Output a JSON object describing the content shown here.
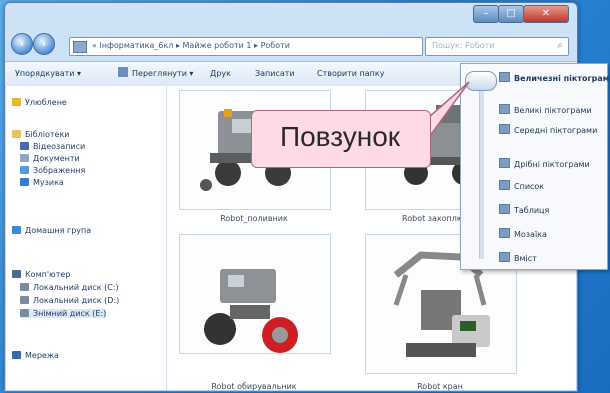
{
  "window": {
    "controls": {
      "minimize": "–",
      "maximize": "□",
      "close": "✕"
    }
  },
  "addressbar": {
    "path": "« Інформатика_6кл ▸ Майже роботи 1 ▸ Роботи",
    "search_placeholder": "Пошук: Роботи"
  },
  "toolbar": {
    "items": [
      "Упорядкувати ▾",
      "Переглянути ▾",
      "Друк",
      "Записати",
      "Створити папку"
    ]
  },
  "sidebar": {
    "items": [
      {
        "label": "Улюблене",
        "icon": "star-icon",
        "color": "#e8b828"
      },
      {
        "label": "Бібліотеки",
        "icon": "library-icon",
        "color": "#e8c25a"
      },
      {
        "label": "Відеозаписи",
        "icon": "video-icon",
        "color": "#4a6aa8"
      },
      {
        "label": "Документи",
        "icon": "documents-icon",
        "color": "#8aa6c8"
      },
      {
        "label": "Зображення",
        "icon": "pictures-icon",
        "color": "#5a9ad8"
      },
      {
        "label": "Музика",
        "icon": "music-icon",
        "color": "#3a7ad0"
      },
      {
        "label": "Домашня група",
        "icon": "homegroup-icon",
        "color": "#3a8ad8"
      },
      {
        "label": "Комп'ютер",
        "icon": "computer-icon",
        "color": "#4a6a90"
      },
      {
        "label": "Локальний диск (C:)",
        "icon": "disk-icon",
        "color": "#7a8aa0"
      },
      {
        "label": "Локальний диск (D:)",
        "icon": "disk-icon",
        "color": "#7a8aa0"
      },
      {
        "label": "Знімний диск (E:)",
        "icon": "usb-icon",
        "color": "#7a8aa0"
      },
      {
        "label": "Мережа",
        "icon": "network-icon",
        "color": "#3a6aa8"
      }
    ]
  },
  "files": [
    {
      "name": "Robot_поливник"
    },
    {
      "name": "Robot захоплювач"
    },
    {
      "name": "Robot обирувальник"
    },
    {
      "name": "Robot кран"
    }
  ],
  "views_menu": {
    "items": [
      {
        "label": "Величезні піктограми",
        "bold": true
      },
      {
        "label": "Великі піктограми",
        "bold": false
      },
      {
        "label": "Середні піктограми",
        "bold": false
      },
      {
        "label": "Дрібні піктограми",
        "bold": false
      },
      {
        "label": "Список",
        "bold": false
      },
      {
        "label": "Таблиця",
        "bold": false
      },
      {
        "label": "Мозаїка",
        "bold": false
      },
      {
        "label": "Вміст",
        "bold": false
      }
    ]
  },
  "callout": {
    "text": "Повзунок"
  }
}
